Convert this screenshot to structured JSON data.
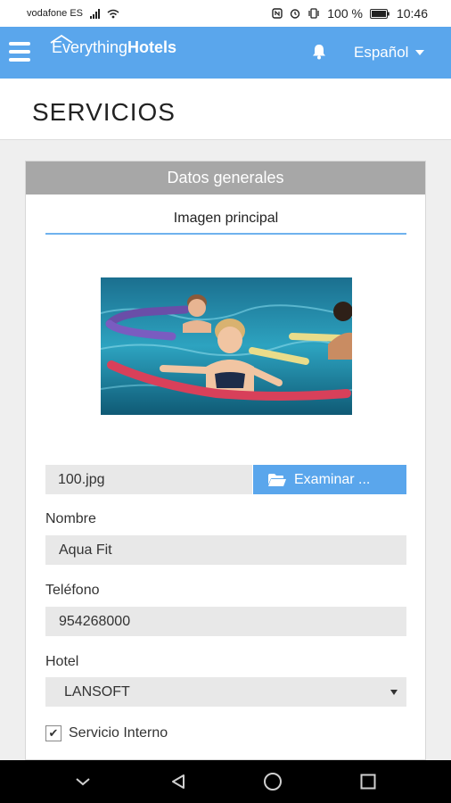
{
  "status": {
    "carrier": "vodafone ES",
    "battery": "100 %",
    "time": "10:46"
  },
  "app": {
    "brand_light": "Everything",
    "brand_bold": "Hotels",
    "language": "Español",
    "accent": "#5aa6ec"
  },
  "page": {
    "title": "SERVICIOS"
  },
  "card": {
    "header": "Datos generales",
    "subtab": "Imagen principal",
    "file_value": "100.jpg",
    "browse_label": "Examinar ...",
    "name_label": "Nombre",
    "name_value": "Aqua Fit",
    "phone_label": "Teléfono",
    "phone_value": "954268000",
    "hotel_label": "Hotel",
    "hotel_value": "LANSOFT",
    "internal_label": "Servicio Interno",
    "internal_checked": true
  },
  "icons": {
    "menu": "menu-icon",
    "bell": "bell-icon",
    "folder": "folder-open-icon",
    "back": "back-icon",
    "home": "home-icon",
    "recents": "recents-icon"
  }
}
